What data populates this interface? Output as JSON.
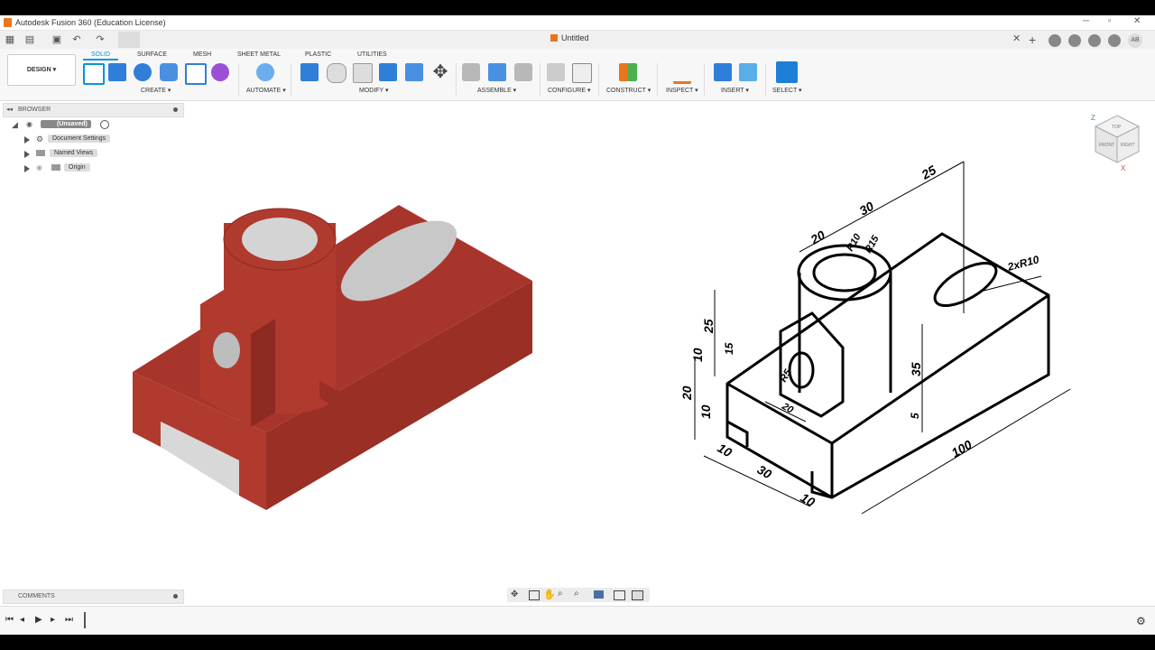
{
  "window": {
    "title": "Autodesk Fusion 360 (Education License)",
    "doc_title": "Untitled"
  },
  "toolbar": {
    "design_label": "DESIGN ▾",
    "workspace_tabs": [
      "SOLID",
      "SURFACE",
      "MESH",
      "SHEET METAL",
      "PLASTIC",
      "UTILITIES"
    ],
    "groups": [
      "CREATE ▾",
      "AUTOMATE ▾",
      "MODIFY ▾",
      "ASSEMBLE ▾",
      "CONFIGURE ▾",
      "CONSTRUCT ▾",
      "INSPECT ▾",
      "INSERT ▾",
      "SELECT ▾"
    ]
  },
  "browser": {
    "header": "BROWSER",
    "root": "(Unsaved)",
    "items": [
      "Document Settings",
      "Named Views",
      "Origin"
    ]
  },
  "comments": {
    "header": "COMMENTS"
  },
  "user": {
    "initials": "AB"
  },
  "viewcube": {
    "faces": [
      "TOP",
      "FRONT",
      "RIGHT"
    ],
    "axes": [
      "Z",
      "X"
    ]
  },
  "drawing": {
    "dims": [
      "25",
      "30",
      "20",
      "R10",
      "R15",
      "2xR10",
      "25",
      "15",
      "10",
      "20",
      "10",
      "R5",
      "20",
      "35",
      "5",
      "10",
      "30",
      "10",
      "100"
    ]
  },
  "colors": {
    "model": "#b03a2e",
    "accent": "#0696d7",
    "cube_orange": "#e8761c"
  }
}
